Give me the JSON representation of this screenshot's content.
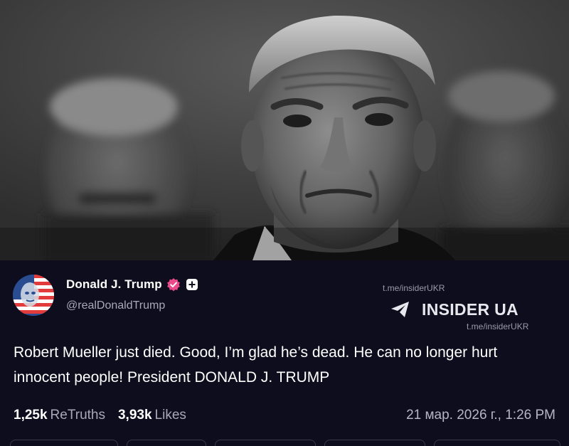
{
  "photo": {
    "alt": "Black and white photo"
  },
  "post": {
    "author_name": "Donald J. Trump",
    "author_handle": "@realDonaldTrump",
    "body": "Robert Mueller just died. Good, I’m glad he’s dead. He can no longer hurt innocent people! President DONALD J. TRUMP",
    "retruths_count": "1,25k",
    "retruths_label": "ReTruths",
    "likes_count": "3,93k",
    "likes_label": "Likes",
    "timestamp": "21 мар. 2026 г., 1:26 PM"
  },
  "watermark": {
    "top": "t.me/insiderUKR",
    "brand": "INSIDER UA",
    "bottom": "t.me/insiderUKR",
    "icon": "telegram-plane-icon"
  },
  "icons": {
    "verified": "verified-badge-icon",
    "plus": "plus-badge-icon"
  },
  "colors": {
    "background": "#0e0d1d",
    "verified": "#e84a8a",
    "muted_text": "#a9a8b8"
  }
}
